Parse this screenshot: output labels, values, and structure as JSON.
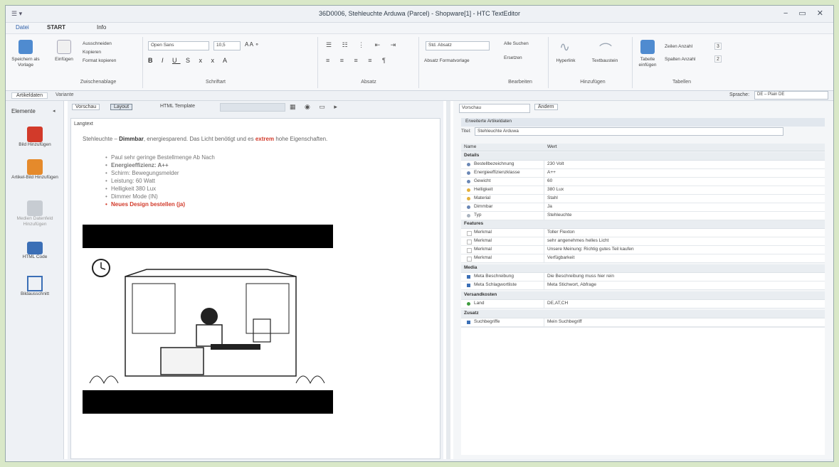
{
  "window": {
    "title": "36D0006, Stehleuchte Arduwa (Parcel) - Shopware[1] - HTC TextEditor",
    "quick_access": "☰ ▾",
    "controls": "− ▭ ✕"
  },
  "menu": {
    "file": "Datei",
    "start": "START",
    "view": "Info"
  },
  "ribbon": {
    "groups": [
      "Zwischenablage",
      "Schriftart",
      "Absatz",
      "Bearbeiten",
      "Hinzufügen",
      "Tabellen"
    ],
    "buttons": {
      "new": "Speichern als Vorlage",
      "paste": "Einfügen",
      "cut": "Ausschneiden",
      "copy": "Kopieren",
      "format_paint": "Format kopieren",
      "find": "Alle Suchen",
      "replace": "Ersetzen",
      "link": "Hyperlink",
      "image": "Textbaustein",
      "table": "Tabelle einfügen",
      "rows": "Zeilen Anzahl",
      "cols": "Spalten Anzahl",
      "rows_val": "3",
      "cols_val": "2"
    },
    "font_name": "Open Sans",
    "font_size": "10,5",
    "style_combo": "Std. Absatz",
    "style_combo2": "Absatz Formatvorlage"
  },
  "tabs": {
    "main": "Artikeldaten",
    "second": "Variante"
  },
  "right_top": {
    "label": "Sprache:",
    "value": "DE – Plain DE"
  },
  "sidebar": {
    "header": "Elemente",
    "items": [
      {
        "label": "Bild Hinzufügen"
      },
      {
        "label": "Artikel-Bild Hinzufügen"
      },
      {
        "label": "Medien Datenfeld Hinzufügen"
      },
      {
        "label": "HTML Code"
      },
      {
        "label": "Bildausschnitt"
      }
    ]
  },
  "editor": {
    "buttons": {
      "preview": "Vorschau",
      "layout": "Layout",
      "html": "HTML Template"
    },
    "section_label": "Langtext",
    "intro_start": "Stehleuchte – ",
    "intro_bold": "Dimmbar",
    "intro_mid": ", energiesparend. Das Licht benötigt und es ",
    "intro_red": "extrem",
    "intro_end": " hohe Eigenschaften.",
    "bullets": [
      "Paul sehr geringe Bestellmenge Ab Nach",
      "Energieeffizienz: A++",
      "Schirm: Bewegungsmelder",
      "Leistung: 60 Watt",
      "Helligkeit 380 Lux",
      "Dimmer Mode (IN)",
      "Neues Design bestellen (ja)"
    ]
  },
  "properties": {
    "combo1": "Vorschau",
    "button1": "Ändern",
    "section": "Erweiterte Artikeldaten",
    "title_label": "Titel:",
    "title_value": "Stehleuchte Arduwa",
    "col_name": "Name",
    "col_value": "Wert",
    "categories": {
      "details": "Details",
      "features": "Features",
      "media": "Media",
      "shipping": "Versandkosten",
      "seo": "Zusatz"
    },
    "details_rows": [
      {
        "k": "Bestellbezeichnung",
        "v": "230 Volt"
      },
      {
        "k": "Energieeffizienzklasse",
        "v": "A++"
      },
      {
        "k": "Gewicht",
        "v": "60"
      },
      {
        "k": "Helligkeit",
        "v": "380 Lux"
      },
      {
        "k": "Material",
        "v": "Stahl"
      },
      {
        "k": "Dimmbar",
        "v": "Ja"
      },
      {
        "k": "Typ",
        "v": "Stehleuchte"
      }
    ],
    "features_rows": [
      {
        "k": "Merkmal",
        "v": "Toller Flexton"
      },
      {
        "k": "Merkmal",
        "v": "sehr angenehmes helles Licht"
      },
      {
        "k": "Merkmal",
        "v": "Unsere Meinung: Richtig gutes Teil kaufen"
      },
      {
        "k": "Merkmal",
        "v": "Verfügbarkeit"
      }
    ],
    "media_rows": [
      {
        "k": "Meta Beschreibung",
        "v": "Die Beschreibung muss hier rein"
      },
      {
        "k": "Meta Schlagwortliste",
        "v": "Meta Stichwort, Abfrage"
      }
    ],
    "shipping_rows": [
      {
        "k": "Land",
        "v": "DE,AT,CH"
      }
    ],
    "seo_rows": [
      {
        "k": "Suchbegriffe",
        "v": "Mein Suchbegriff"
      }
    ]
  },
  "colors": {
    "accent_red": "#d23a2a",
    "blue": "#3b6fb6",
    "green": "#3e9b3e"
  }
}
